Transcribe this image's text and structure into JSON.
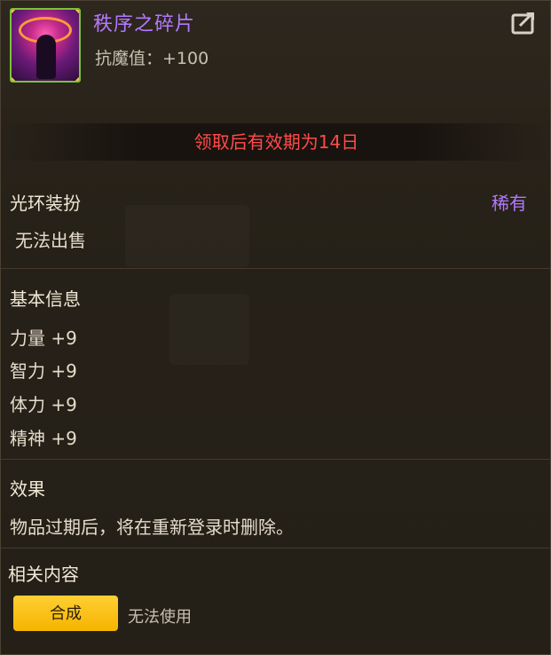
{
  "item": {
    "name": "秩序之碎片",
    "stat_line": "抗魔值：+100",
    "icon": "order-shard-item-icon"
  },
  "header": {
    "share_icon": "share-export-icon"
  },
  "expiry": {
    "text": "领取后有效期为14日",
    "color": "#ff4b4b"
  },
  "aura": {
    "title": "光环装扮",
    "rarity": "稀有",
    "rarity_color": "#b478ff",
    "trade_status": "无法出售"
  },
  "basic_info": {
    "title": "基本信息",
    "stats": [
      "力量 +9",
      "智力 +9",
      "体力 +9",
      "精神 +9"
    ]
  },
  "effect": {
    "title": "效果",
    "text": "物品过期后，将在重新登录时删除。"
  },
  "related": {
    "title": "相关内容",
    "synth_button": "合成",
    "status": "无法使用"
  },
  "colors": {
    "accent_button": "#f5b400",
    "name": "#b478ff",
    "panel_bg": "#262118"
  }
}
